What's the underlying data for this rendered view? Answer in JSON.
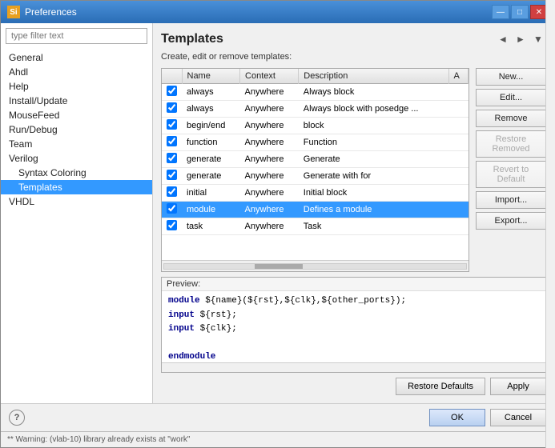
{
  "window": {
    "title": "Preferences",
    "icon_label": "Si"
  },
  "title_controls": {
    "minimize": "—",
    "maximize": "□",
    "close": "✕"
  },
  "sidebar": {
    "filter_placeholder": "type filter text",
    "items": [
      {
        "label": "General",
        "indent": 0
      },
      {
        "label": "Ahdl",
        "indent": 0
      },
      {
        "label": "Help",
        "indent": 0
      },
      {
        "label": "Install/Update",
        "indent": 0
      },
      {
        "label": "MouseFeed",
        "indent": 0
      },
      {
        "label": "Run/Debug",
        "indent": 0
      },
      {
        "label": "Team",
        "indent": 0
      },
      {
        "label": "Verilog",
        "indent": 0
      },
      {
        "label": "Syntax Coloring",
        "indent": 1
      },
      {
        "label": "Templates",
        "indent": 1,
        "selected": true
      },
      {
        "label": "VHDL",
        "indent": 0
      }
    ]
  },
  "panel": {
    "title": "Templates",
    "subtitle": "Create, edit or remove templates:"
  },
  "toolbar": {
    "back": "◀",
    "forward": "▶",
    "menu": "▾"
  },
  "table": {
    "columns": [
      "Name",
      "Context",
      "Description",
      "A"
    ],
    "rows": [
      {
        "checked": true,
        "name": "always",
        "context": "Anywhere",
        "description": "Always block",
        "selected": false
      },
      {
        "checked": true,
        "name": "always",
        "context": "Anywhere",
        "description": "Always block with posedge ...",
        "selected": false
      },
      {
        "checked": true,
        "name": "begin/end",
        "context": "Anywhere",
        "description": "block",
        "selected": false
      },
      {
        "checked": true,
        "name": "function",
        "context": "Anywhere",
        "description": "Function",
        "selected": false
      },
      {
        "checked": true,
        "name": "generate",
        "context": "Anywhere",
        "description": "Generate",
        "selected": false
      },
      {
        "checked": true,
        "name": "generate",
        "context": "Anywhere",
        "description": "Generate with for",
        "selected": false
      },
      {
        "checked": true,
        "name": "initial",
        "context": "Anywhere",
        "description": "Initial block",
        "selected": false
      },
      {
        "checked": true,
        "name": "module",
        "context": "Anywhere",
        "description": "Defines a module",
        "selected": true
      },
      {
        "checked": true,
        "name": "task",
        "context": "Anywhere",
        "description": "Task",
        "selected": false
      }
    ]
  },
  "side_buttons": {
    "new": "New...",
    "edit": "Edit...",
    "remove": "Remove",
    "restore_removed": "Restore Removed",
    "revert_to_default": "Revert to Default",
    "import": "Import...",
    "export": "Export..."
  },
  "preview": {
    "label": "Preview:",
    "lines": [
      {
        "type": "code",
        "parts": [
          {
            "kw": true,
            "text": "module"
          },
          {
            "text": " ${name}(${rst},${clk},${other_ports});"
          }
        ]
      },
      {
        "type": "code",
        "parts": [
          {
            "kw": true,
            "text": "input"
          },
          {
            "text": " ${rst};"
          }
        ]
      },
      {
        "type": "code",
        "parts": [
          {
            "kw": true,
            "text": "input"
          },
          {
            "text": " ${clk};"
          }
        ]
      },
      {
        "type": "blank"
      },
      {
        "type": "code",
        "parts": [
          {
            "kw": true,
            "text": "endmodule"
          }
        ]
      }
    ]
  },
  "bottom_buttons": {
    "restore_defaults": "Restore Defaults",
    "apply": "Apply",
    "ok": "OK",
    "cancel": "Cancel"
  },
  "status_bar": {
    "text": "** Warning: (vlab-10) library already exists at \"work\""
  }
}
